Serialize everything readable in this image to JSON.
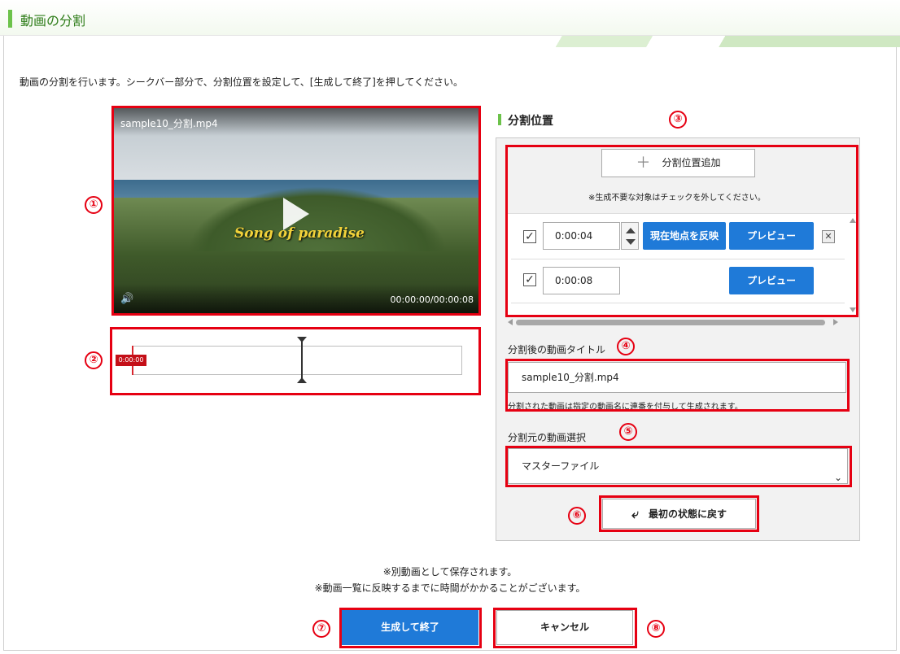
{
  "header": {
    "title": "動画の分割"
  },
  "instruction": "動画の分割を行います。シークバー部分で、分割位置を設定して、[生成して終了]を押してください。",
  "video": {
    "filename": "sample10_分割.mp4",
    "overlay_text": "Song of paradise",
    "time": "00:00:00/00:00:08"
  },
  "seekbar": {
    "current_tag": "0:00:00"
  },
  "split_panel": {
    "heading": "分割位置",
    "add_button": "分割位置追加",
    "note": "※生成不要な対象はチェックを外してください。",
    "rows": [
      {
        "checked": "✓",
        "time": "0:00:04",
        "reflect_button": "現在地点を反映",
        "preview_button": "プレビュー",
        "remove": "✕"
      },
      {
        "checked": "✓",
        "time": "0:00:08",
        "preview_button": "プレビュー"
      }
    ]
  },
  "title_section": {
    "label": "分割後の動画タイトル",
    "value": "sample10_分割.mp4",
    "note": "分割された動画は指定の動画名に連番を付与して生成されます。"
  },
  "source_section": {
    "label": "分割元の動画選択",
    "selected": "マスターファイル"
  },
  "reset_button": "最初の状態に戻す",
  "footer": {
    "note1": "※別動画として保存されます。",
    "note2": "※動画一覧に反映するまでに時間がかかることがございます。",
    "generate_button": "生成して終了",
    "cancel_button": "キャンセル"
  },
  "markers": [
    "①",
    "②",
    "③",
    "④",
    "⑤",
    "⑥",
    "⑦",
    "⑧"
  ],
  "colors": {
    "accent_green": "#6cc24a",
    "primary_blue": "#1f7ad8",
    "annotation_red": "#e60012"
  }
}
